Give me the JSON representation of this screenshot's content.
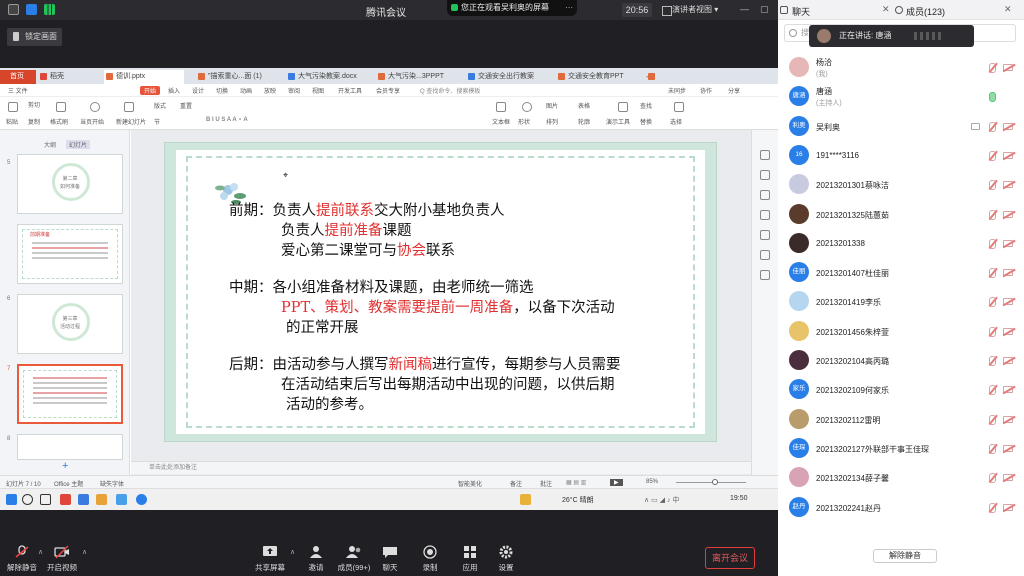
{
  "window": {
    "title": "腾讯会议",
    "screen_badge": "您正在观看吴利奥的屏幕",
    "time": "20:56",
    "view_label": "演讲者视图",
    "lock_label": "锁定画面"
  },
  "ppt": {
    "tabs": [
      "首页",
      "稻壳",
      "德训.pptx",
      "\"描索重心...面 (1)",
      "大气污染教案.docx",
      "大气污染...3PPPT",
      "交通安全出行教案",
      "交通安全教育PPT"
    ],
    "menus": [
      "三 文件",
      "开始",
      "插入",
      "设计",
      "切换",
      "动画",
      "放映",
      "审阅",
      "视图",
      "开发工具",
      "会员专享"
    ],
    "search_hint": "Q 查找命令、搜索模板",
    "right_menus": [
      "未同步",
      "协作",
      "分享"
    ],
    "toolbar": [
      "粘贴",
      "剪切",
      "复制",
      "格式刷",
      "当页开始",
      "新建幻灯片",
      "版式",
      "节",
      "重置",
      "文本框",
      "形状",
      "排列",
      "演示工具",
      "查找",
      "替换",
      "选择",
      "图片",
      "表格",
      "轮廓"
    ],
    "side_tabs": [
      "大纲",
      "幻灯片"
    ],
    "slide_numbers": [
      "5",
      "6",
      "7",
      "8"
    ],
    "thumb_texts": {
      "t1a": "第二章",
      "t1b": "如何准备",
      "t2": "前期准备",
      "t3a": "第三章",
      "t3b": "活动过程"
    },
    "slide": {
      "s1": {
        "a": "前期：负责人",
        "b": "提前联系",
        "c": "交大附小基地负责人"
      },
      "s2": {
        "a": "负责人",
        "b": "提前准备",
        "c": "课题"
      },
      "s3": {
        "a": "爱心第二课堂可与",
        "b": "协会",
        "c": "联系"
      },
      "m1": "中期：各小组准备材料及课题，由老师统一筛选",
      "m2": {
        "a": "PPT、策划、教案需要提前一周准备",
        "b": "，以备下次活动"
      },
      "m3": "的正常开展",
      "l1": {
        "a": "后期：由活动参与人撰写",
        "b": "新闻稿",
        "c": "进行宣传，每期参与人员需要"
      },
      "l2": "在活动结束后写出每期活动中出现的问题，以供后期",
      "l3": "活动的参考。"
    },
    "notes_placeholder": "单击此处添加备注",
    "status": {
      "page": "幻灯片 7 / 10",
      "theme": "Office 主题",
      "font_missing": "缺失字体",
      "beautify": "智能美化",
      "notes": "备注",
      "comments": "批注",
      "zoom": "85%"
    },
    "taskbar": {
      "weather": "26°C 晴朗",
      "clock": "19:50"
    }
  },
  "controls": {
    "mute": "解除静音",
    "video": "开启视频",
    "share": "共享屏幕",
    "invite": "邀请",
    "members": "成员(99+)",
    "chat": "聊天",
    "record": "录制",
    "apps": "应用",
    "settings": "设置",
    "leave": "离开会议"
  },
  "panel": {
    "chat_tab": "聊天",
    "members_tab": "成员(123)",
    "search_placeholder": "搜",
    "speaking": "正在讲话: 唐涵",
    "unmute_all": "解除静音",
    "members": [
      {
        "name": "杨洽",
        "sub": "(我)",
        "avatar": "",
        "color": "#e7b7b7",
        "mic": "off"
      },
      {
        "name": "唐涵",
        "sub": "(主持人)",
        "avatar": "唐涵",
        "color": "#2a7ee8",
        "mic": "on"
      },
      {
        "name": "吴利奥",
        "sub": "",
        "avatar": "利奥",
        "color": "#2a7ee8",
        "mic": "off"
      },
      {
        "name": "191****3116",
        "sub": "",
        "avatar": "16",
        "color": "#2a7ee8",
        "mic": "off"
      },
      {
        "name": "20213201301蔡咏洁",
        "sub": "",
        "avatar": "",
        "color": "#c8cbe0",
        "mic": "off"
      },
      {
        "name": "20213201325陆蕙茹",
        "sub": "",
        "avatar": "",
        "color": "#5b3b2b",
        "mic": "off"
      },
      {
        "name": "20213201338",
        "sub": "",
        "avatar": "",
        "color": "#3a2a2a",
        "mic": "off"
      },
      {
        "name": "20213201407杜佳丽",
        "sub": "",
        "avatar": "佳丽",
        "color": "#2a7ee8",
        "mic": "off"
      },
      {
        "name": "20213201419李乐",
        "sub": "",
        "avatar": "",
        "color": "#b5d6ee",
        "mic": "off"
      },
      {
        "name": "20213201456朱梓萱",
        "sub": "",
        "avatar": "",
        "color": "#e8c36a",
        "mic": "off"
      },
      {
        "name": "20213202104高丙璐",
        "sub": "",
        "avatar": "",
        "color": "#4a2e3e",
        "mic": "off"
      },
      {
        "name": "20213202109何家乐",
        "sub": "",
        "avatar": "家乐",
        "color": "#2a7ee8",
        "mic": "off"
      },
      {
        "name": "20213202112雷明",
        "sub": "",
        "avatar": "",
        "color": "#b89c6c",
        "mic": "off"
      },
      {
        "name": "20213202127外联部干事王佳琛",
        "sub": "",
        "avatar": "佳琛",
        "color": "#2a7ee8",
        "mic": "off"
      },
      {
        "name": "20213202134薛子馨",
        "sub": "",
        "avatar": "",
        "color": "#d9a3b6",
        "mic": "off"
      },
      {
        "name": "20213202241赵丹",
        "sub": "",
        "avatar": "赵丹",
        "color": "#2a7ee8",
        "mic": "off"
      }
    ]
  },
  "colors": {
    "accent_red": "#e03030",
    "host_blue": "#2a7ee8",
    "wps_red": "#d7452b"
  }
}
